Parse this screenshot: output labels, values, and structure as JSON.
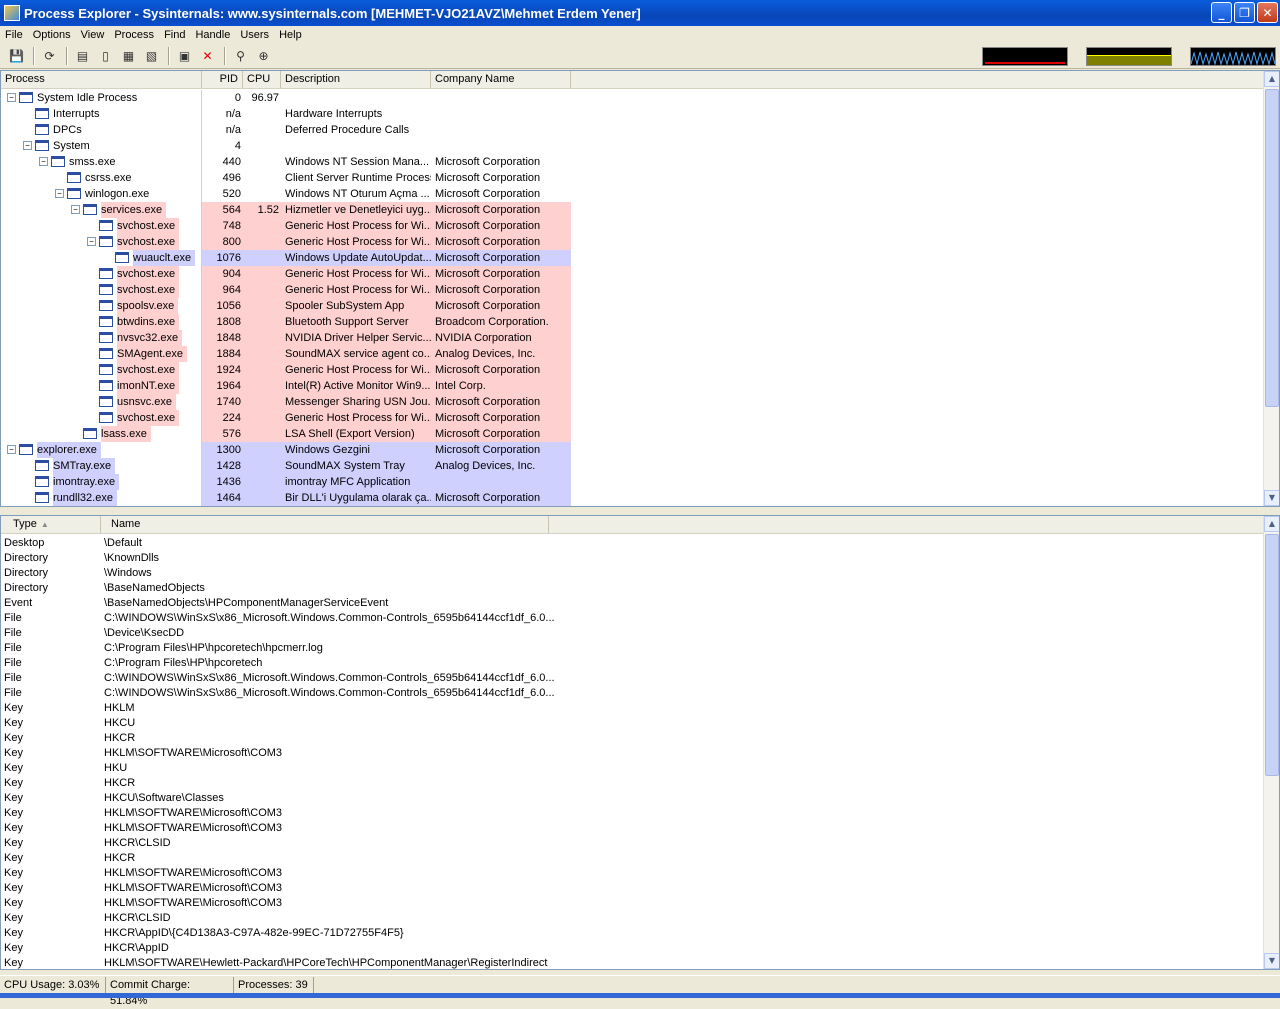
{
  "window": {
    "title": "Process Explorer - Sysinternals: www.sysinternals.com [MEHMET-VJO21AVZ\\Mehmet Erdem Yener]"
  },
  "menu": [
    "File",
    "Options",
    "View",
    "Process",
    "Find",
    "Handle",
    "Users",
    "Help"
  ],
  "toolbar_icons": [
    "save-icon",
    "refresh-icon",
    "system-info-icon",
    "properties-icon",
    "dll-view-icon",
    "handle-view-icon",
    "process-properties-icon",
    "kill-process-icon",
    "find-icon",
    "target-icon"
  ],
  "process_pane": {
    "columns": [
      "Process",
      "PID",
      "CPU",
      "Description",
      "Company Name"
    ],
    "rows": [
      {
        "name": "System Idle Process",
        "pid": "0",
        "cpu": "96.97",
        "desc": "",
        "company": "",
        "level": 0,
        "toggle": "−",
        "color": ""
      },
      {
        "name": "Interrupts",
        "pid": "n/a",
        "cpu": "",
        "desc": "Hardware Interrupts",
        "company": "",
        "level": 1,
        "toggle": "",
        "color": ""
      },
      {
        "name": "DPCs",
        "pid": "n/a",
        "cpu": "",
        "desc": "Deferred Procedure Calls",
        "company": "",
        "level": 1,
        "toggle": "",
        "color": ""
      },
      {
        "name": "System",
        "pid": "4",
        "cpu": "",
        "desc": "",
        "company": "",
        "level": 1,
        "toggle": "−",
        "color": ""
      },
      {
        "name": "smss.exe",
        "pid": "440",
        "cpu": "",
        "desc": "Windows NT Session Mana...",
        "company": "Microsoft Corporation",
        "level": 2,
        "toggle": "−",
        "color": ""
      },
      {
        "name": "csrss.exe",
        "pid": "496",
        "cpu": "",
        "desc": "Client Server Runtime Process",
        "company": "Microsoft Corporation",
        "level": 3,
        "toggle": "",
        "color": ""
      },
      {
        "name": "winlogon.exe",
        "pid": "520",
        "cpu": "",
        "desc": "Windows NT Oturum Açma ...",
        "company": "Microsoft Corporation",
        "level": 3,
        "toggle": "−",
        "color": ""
      },
      {
        "name": "services.exe",
        "pid": "564",
        "cpu": "1.52",
        "desc": "Hizmetler ve Denetleyici uyg...",
        "company": "Microsoft Corporation",
        "level": 4,
        "toggle": "−",
        "color": "pink"
      },
      {
        "name": "svchost.exe",
        "pid": "748",
        "cpu": "",
        "desc": "Generic Host Process for Wi...",
        "company": "Microsoft Corporation",
        "level": 5,
        "toggle": "",
        "color": "pink"
      },
      {
        "name": "svchost.exe",
        "pid": "800",
        "cpu": "",
        "desc": "Generic Host Process for Wi...",
        "company": "Microsoft Corporation",
        "level": 5,
        "toggle": "−",
        "color": "pink"
      },
      {
        "name": "wuauclt.exe",
        "pid": "1076",
        "cpu": "",
        "desc": "Windows Update AutoUpdat...",
        "company": "Microsoft Corporation",
        "level": 6,
        "toggle": "",
        "color": "blue"
      },
      {
        "name": "svchost.exe",
        "pid": "904",
        "cpu": "",
        "desc": "Generic Host Process for Wi...",
        "company": "Microsoft Corporation",
        "level": 5,
        "toggle": "",
        "color": "pink"
      },
      {
        "name": "svchost.exe",
        "pid": "964",
        "cpu": "",
        "desc": "Generic Host Process for Wi...",
        "company": "Microsoft Corporation",
        "level": 5,
        "toggle": "",
        "color": "pink"
      },
      {
        "name": "spoolsv.exe",
        "pid": "1056",
        "cpu": "",
        "desc": "Spooler SubSystem App",
        "company": "Microsoft Corporation",
        "level": 5,
        "toggle": "",
        "color": "pink"
      },
      {
        "name": "btwdins.exe",
        "pid": "1808",
        "cpu": "",
        "desc": "Bluetooth Support Server",
        "company": "Broadcom Corporation.",
        "level": 5,
        "toggle": "",
        "color": "pink"
      },
      {
        "name": "nvsvc32.exe",
        "pid": "1848",
        "cpu": "",
        "desc": "NVIDIA Driver Helper Servic...",
        "company": "NVIDIA Corporation",
        "level": 5,
        "toggle": "",
        "color": "pink"
      },
      {
        "name": "SMAgent.exe",
        "pid": "1884",
        "cpu": "",
        "desc": "SoundMAX service agent co...",
        "company": "Analog Devices, Inc.",
        "level": 5,
        "toggle": "",
        "color": "pink"
      },
      {
        "name": "svchost.exe",
        "pid": "1924",
        "cpu": "",
        "desc": "Generic Host Process for Wi...",
        "company": "Microsoft Corporation",
        "level": 5,
        "toggle": "",
        "color": "pink"
      },
      {
        "name": "imonNT.exe",
        "pid": "1964",
        "cpu": "",
        "desc": "Intel(R) Active Monitor Win9...",
        "company": "Intel Corp.",
        "level": 5,
        "toggle": "",
        "color": "pink"
      },
      {
        "name": "usnsvc.exe",
        "pid": "1740",
        "cpu": "",
        "desc": "Messenger Sharing USN Jou...",
        "company": "Microsoft Corporation",
        "level": 5,
        "toggle": "",
        "color": "pink"
      },
      {
        "name": "svchost.exe",
        "pid": "224",
        "cpu": "",
        "desc": "Generic Host Process for Wi...",
        "company": "Microsoft Corporation",
        "level": 5,
        "toggle": "",
        "color": "pink"
      },
      {
        "name": "lsass.exe",
        "pid": "576",
        "cpu": "",
        "desc": "LSA Shell (Export Version)",
        "company": "Microsoft Corporation",
        "level": 4,
        "toggle": "",
        "color": "pink"
      },
      {
        "name": "explorer.exe",
        "pid": "1300",
        "cpu": "",
        "desc": "Windows Gezgini",
        "company": "Microsoft Corporation",
        "level": 0,
        "toggle": "−",
        "color": "blue"
      },
      {
        "name": "SMTray.exe",
        "pid": "1428",
        "cpu": "",
        "desc": "SoundMAX System Tray",
        "company": "Analog Devices, Inc.",
        "level": 1,
        "toggle": "",
        "color": "blue"
      },
      {
        "name": "imontray.exe",
        "pid": "1436",
        "cpu": "",
        "desc": "imontray MFC Application",
        "company": "",
        "level": 1,
        "toggle": "",
        "color": "blue"
      },
      {
        "name": "rundll32.exe",
        "pid": "1464",
        "cpu": "",
        "desc": "Bir DLL'i Uygulama olarak ça...",
        "company": "Microsoft Corporation",
        "level": 1,
        "toggle": "",
        "color": "blue"
      }
    ]
  },
  "handle_pane": {
    "columns": [
      "Type",
      "Name"
    ],
    "rows": [
      {
        "type": "Desktop",
        "name": "\\Default"
      },
      {
        "type": "Directory",
        "name": "\\KnownDlls"
      },
      {
        "type": "Directory",
        "name": "\\Windows"
      },
      {
        "type": "Directory",
        "name": "\\BaseNamedObjects"
      },
      {
        "type": "Event",
        "name": "\\BaseNamedObjects\\HPComponentManagerServiceEvent"
      },
      {
        "type": "File",
        "name": "C:\\WINDOWS\\WinSxS\\x86_Microsoft.Windows.Common-Controls_6595b64144ccf1df_6.0..."
      },
      {
        "type": "File",
        "name": "\\Device\\KsecDD"
      },
      {
        "type": "File",
        "name": "C:\\Program Files\\HP\\hpcoretech\\hpcmerr.log"
      },
      {
        "type": "File",
        "name": "C:\\Program Files\\HP\\hpcoretech"
      },
      {
        "type": "File",
        "name": "C:\\WINDOWS\\WinSxS\\x86_Microsoft.Windows.Common-Controls_6595b64144ccf1df_6.0..."
      },
      {
        "type": "File",
        "name": "C:\\WINDOWS\\WinSxS\\x86_Microsoft.Windows.Common-Controls_6595b64144ccf1df_6.0..."
      },
      {
        "type": "Key",
        "name": "HKLM"
      },
      {
        "type": "Key",
        "name": "HKCU"
      },
      {
        "type": "Key",
        "name": "HKCR"
      },
      {
        "type": "Key",
        "name": "HKLM\\SOFTWARE\\Microsoft\\COM3"
      },
      {
        "type": "Key",
        "name": "HKU"
      },
      {
        "type": "Key",
        "name": "HKCR"
      },
      {
        "type": "Key",
        "name": "HKCU\\Software\\Classes"
      },
      {
        "type": "Key",
        "name": "HKLM\\SOFTWARE\\Microsoft\\COM3"
      },
      {
        "type": "Key",
        "name": "HKLM\\SOFTWARE\\Microsoft\\COM3"
      },
      {
        "type": "Key",
        "name": "HKCR\\CLSID"
      },
      {
        "type": "Key",
        "name": "HKCR"
      },
      {
        "type": "Key",
        "name": "HKLM\\SOFTWARE\\Microsoft\\COM3"
      },
      {
        "type": "Key",
        "name": "HKLM\\SOFTWARE\\Microsoft\\COM3"
      },
      {
        "type": "Key",
        "name": "HKLM\\SOFTWARE\\Microsoft\\COM3"
      },
      {
        "type": "Key",
        "name": "HKCR\\CLSID"
      },
      {
        "type": "Key",
        "name": "HKCR\\AppID\\{C4D138A3-C97A-482e-99EC-71D72755F4F5}"
      },
      {
        "type": "Key",
        "name": "HKCR\\AppID"
      },
      {
        "type": "Key",
        "name": "HKLM\\SOFTWARE\\Hewlett-Packard\\HPCoreTech\\HPComponentManager\\RegisterIndirect"
      }
    ]
  },
  "status": {
    "cpu_usage": "CPU Usage: 3.03%",
    "commit_charge": "Commit Charge: 51.84%",
    "processes": "Processes: 39"
  },
  "colors": {
    "services_row": "#ffd0d0",
    "own_process_row": "#d0d0ff",
    "title_bar": "#0a5ddc"
  }
}
